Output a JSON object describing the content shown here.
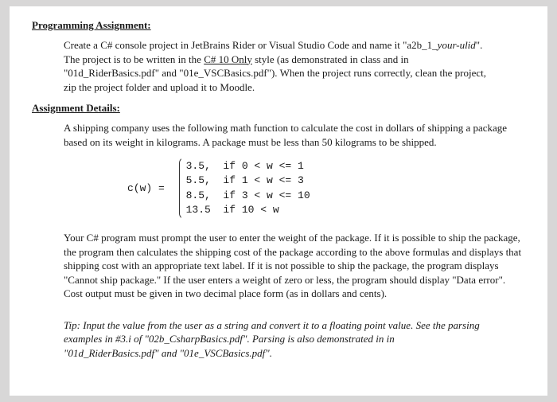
{
  "headings": {
    "programming": "Programming Assignment:",
    "details": "Assignment Details:"
  },
  "intro": {
    "l1a": "Create a C# console project in JetBrains Rider or Visual Studio Code and name it \"a2b_1_",
    "l1b": "your-ulid",
    "l1c": "\".",
    "l2a": "The project is to be written in the ",
    "l2b": "C# 10 Only",
    "l2c": " style (as demonstrated in class and in",
    "l3": "\"01d_RiderBasics.pdf\" and \"01e_VSCBasics.pdf\").  When the project runs correctly, clean the project,",
    "l4": "zip the project folder and upload it to Moodle."
  },
  "details": {
    "p1": "A shipping company uses the following math function to calculate the cost in dollars of shipping a package based on its weight in kilograms.  A package must be less than 50 kilograms to be shipped."
  },
  "formula": {
    "label": "c(w) = ",
    "r1": "3.5,  if 0 < w <= 1",
    "r2": "5.5,  if 1 < w <= 3",
    "r3": "8.5,  if 3 < w <= 10",
    "r4": "13.5  if 10 < w"
  },
  "body": {
    "p2": "Your C# program must prompt the user to enter the weight of the package.  If it is possible to ship the package, the program then calculates the shipping cost of the package according to the above formulas and displays that shipping cost with an appropriate text label.  If it is not possible to ship the package, the program displays \"Cannot ship package.\"  If the user enters a weight of zero or less, the program should display \"Data error\".  Cost output must be given in two decimal place form (as in dollars and cents)."
  },
  "tip": {
    "l1": "Tip:  Input the value from the user as a string and convert it to a floating point value.  See the parsing",
    "l2": "examples in #3.i of \"02b_CsharpBasics.pdf\".  Parsing is also demonstrated in in",
    "l3": "\"01d_RiderBasics.pdf\" and \"01e_VSCBasics.pdf\"."
  }
}
